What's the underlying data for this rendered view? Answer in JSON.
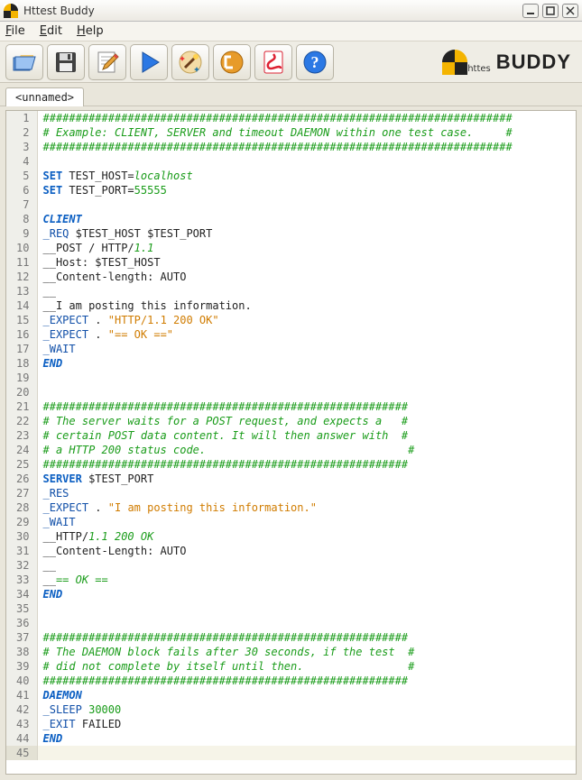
{
  "window": {
    "title": "Httest Buddy"
  },
  "menus": {
    "file": "File",
    "edit": "Edit",
    "help": "Help"
  },
  "toolbar": {
    "open": "Open",
    "save": "Save",
    "edit": "Edit",
    "run": "Run",
    "wizard": "Wizard",
    "log": "Log",
    "pdf": "PDF",
    "help": "Help"
  },
  "logo": {
    "sub": "httes",
    "main": "BUDDY"
  },
  "tab": {
    "label": "<unnamed>"
  },
  "code": {
    "lines": [
      {
        "n": 1,
        "tok": [
          [
            "comment",
            "########################################################################"
          ]
        ]
      },
      {
        "n": 2,
        "tok": [
          [
            "comment",
            "# Example: CLIENT, SERVER and timeout DAEMON within one test case.     #"
          ]
        ]
      },
      {
        "n": 3,
        "tok": [
          [
            "comment",
            "########################################################################"
          ]
        ]
      },
      {
        "n": 4,
        "tok": []
      },
      {
        "n": 5,
        "tok": [
          [
            "kw1",
            "SET"
          ],
          [
            "txt",
            " TEST_HOST="
          ],
          [
            "httpver",
            "localhost"
          ]
        ]
      },
      {
        "n": 6,
        "tok": [
          [
            "kw1",
            "SET"
          ],
          [
            "txt",
            " TEST_PORT="
          ],
          [
            "num",
            "55555"
          ]
        ]
      },
      {
        "n": 7,
        "tok": []
      },
      {
        "n": 8,
        "tok": [
          [
            "kw1i",
            "CLIENT"
          ]
        ]
      },
      {
        "n": 9,
        "tok": [
          [
            "cmd",
            "_REQ"
          ],
          [
            "txt",
            " $TEST_HOST $TEST_PORT"
          ]
        ]
      },
      {
        "n": 10,
        "tok": [
          [
            "txt",
            "__POST / HTTP/"
          ],
          [
            "httpver",
            "1.1"
          ]
        ]
      },
      {
        "n": 11,
        "tok": [
          [
            "txt",
            "__Host: $TEST_HOST"
          ]
        ]
      },
      {
        "n": 12,
        "tok": [
          [
            "txt",
            "__Content-length: AUTO"
          ]
        ]
      },
      {
        "n": 13,
        "tok": [
          [
            "txt",
            "__"
          ]
        ]
      },
      {
        "n": 14,
        "tok": [
          [
            "txt",
            "__I am posting this information."
          ]
        ]
      },
      {
        "n": 15,
        "tok": [
          [
            "cmd",
            "_EXPECT"
          ],
          [
            "txt",
            " . "
          ],
          [
            "str",
            "\"HTTP/1.1 200 OK\""
          ]
        ]
      },
      {
        "n": 16,
        "tok": [
          [
            "cmd",
            "_EXPECT"
          ],
          [
            "txt",
            " . "
          ],
          [
            "str",
            "\"== OK ==\""
          ]
        ]
      },
      {
        "n": 17,
        "tok": [
          [
            "cmd",
            "_WAIT"
          ]
        ]
      },
      {
        "n": 18,
        "tok": [
          [
            "kw1i",
            "END"
          ]
        ]
      },
      {
        "n": 19,
        "tok": []
      },
      {
        "n": 20,
        "tok": []
      },
      {
        "n": 21,
        "tok": [
          [
            "comment",
            "########################################################"
          ]
        ]
      },
      {
        "n": 22,
        "tok": [
          [
            "comment",
            "# The server waits for a POST request, and expects a   #"
          ]
        ]
      },
      {
        "n": 23,
        "tok": [
          [
            "comment",
            "# certain POST data content. It will then answer with  #"
          ]
        ]
      },
      {
        "n": 24,
        "tok": [
          [
            "comment",
            "# a HTTP 200 status code.                               #"
          ]
        ]
      },
      {
        "n": 25,
        "tok": [
          [
            "comment",
            "########################################################"
          ]
        ]
      },
      {
        "n": 26,
        "tok": [
          [
            "kw1",
            "SERVER"
          ],
          [
            "txt",
            " $TEST_PORT"
          ]
        ]
      },
      {
        "n": 27,
        "tok": [
          [
            "cmd",
            "_RES"
          ]
        ]
      },
      {
        "n": 28,
        "tok": [
          [
            "cmd",
            "_EXPECT"
          ],
          [
            "txt",
            " . "
          ],
          [
            "str",
            "\"I am posting this information.\""
          ]
        ]
      },
      {
        "n": 29,
        "tok": [
          [
            "cmd",
            "_WAIT"
          ]
        ]
      },
      {
        "n": 30,
        "tok": [
          [
            "txt",
            "__HTTP/"
          ],
          [
            "httpok",
            "1.1 200 OK"
          ]
        ]
      },
      {
        "n": 31,
        "tok": [
          [
            "txt",
            "__Content-Length: AUTO"
          ]
        ]
      },
      {
        "n": 32,
        "tok": [
          [
            "txt",
            "__"
          ]
        ]
      },
      {
        "n": 33,
        "tok": [
          [
            "txt",
            "__"
          ],
          [
            "httpok",
            "== OK =="
          ]
        ]
      },
      {
        "n": 34,
        "tok": [
          [
            "kw1i",
            "END"
          ]
        ]
      },
      {
        "n": 35,
        "tok": []
      },
      {
        "n": 36,
        "tok": []
      },
      {
        "n": 37,
        "tok": [
          [
            "comment",
            "########################################################"
          ]
        ]
      },
      {
        "n": 38,
        "tok": [
          [
            "comment",
            "# The DAEMON block fails after 30 seconds, if the test  #"
          ]
        ]
      },
      {
        "n": 39,
        "tok": [
          [
            "comment",
            "# did not complete by itself until then.                #"
          ]
        ]
      },
      {
        "n": 40,
        "tok": [
          [
            "comment",
            "########################################################"
          ]
        ]
      },
      {
        "n": 41,
        "tok": [
          [
            "kw1i",
            "DAEMON"
          ]
        ]
      },
      {
        "n": 42,
        "tok": [
          [
            "cmd",
            "_SLEEP"
          ],
          [
            "txt",
            " "
          ],
          [
            "num",
            "30000"
          ]
        ]
      },
      {
        "n": 43,
        "tok": [
          [
            "cmd",
            "_EXIT"
          ],
          [
            "txt",
            " FAILED"
          ]
        ]
      },
      {
        "n": 44,
        "tok": [
          [
            "kw1i",
            "END"
          ]
        ]
      },
      {
        "n": 45,
        "tok": []
      }
    ],
    "cursor_line": 45
  }
}
